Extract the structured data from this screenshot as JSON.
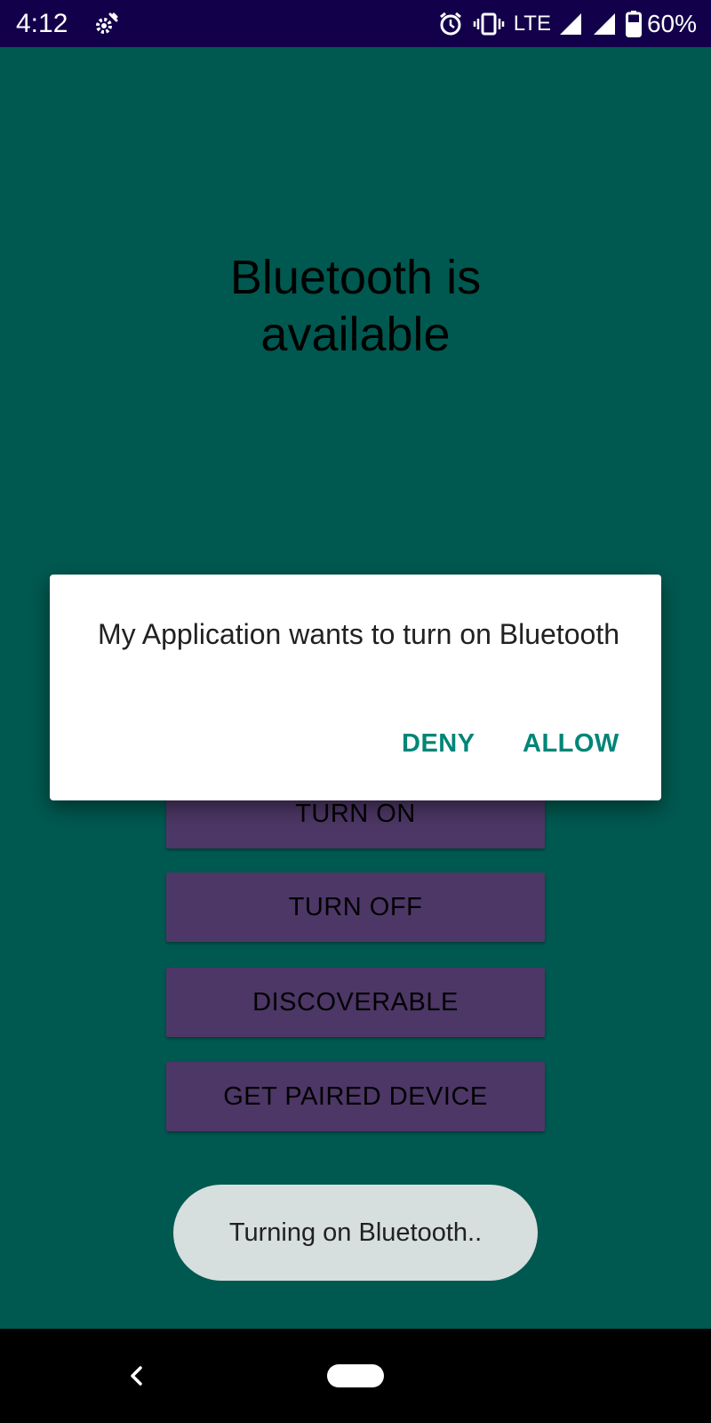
{
  "status_bar": {
    "time": "4:12",
    "network_type": "LTE",
    "battery_percent": "60%",
    "icons": [
      "settings-gear-icon",
      "alarm-icon",
      "vibrate-icon",
      "signal-icon",
      "signal-icon",
      "battery-icon"
    ],
    "background_color": "#13004a"
  },
  "main": {
    "headline": "Bluetooth is available",
    "background_color": "#005950"
  },
  "buttons": {
    "turn_on": "TURN ON",
    "turn_off": "TURN OFF",
    "discoverable": "DISCOVERABLE",
    "get_paired_device": "GET PAIRED DEVICE",
    "color": "#4d3766"
  },
  "dialog": {
    "message": "My Application wants to turn on Bluetooth",
    "deny_label": "DENY",
    "allow_label": "ALLOW",
    "accent_color": "#008577"
  },
  "toast": {
    "text": "Turning on Bluetooth.."
  },
  "nav_bar": {
    "icons": [
      "back-icon",
      "home-pill-icon"
    ]
  }
}
